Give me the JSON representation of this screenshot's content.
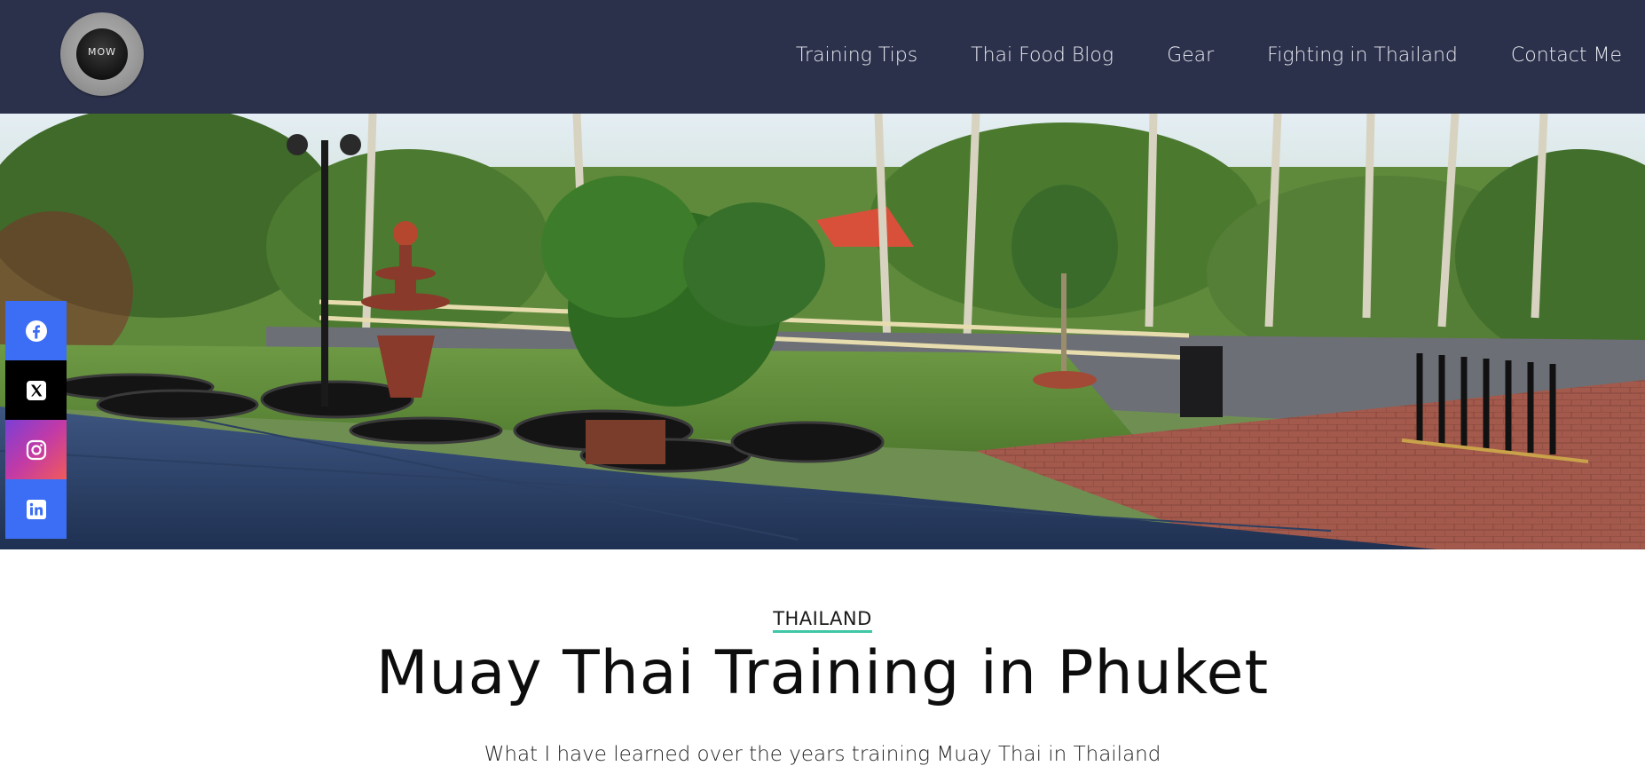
{
  "header": {
    "logo_text": "MOW",
    "nav": [
      {
        "label": "Training Tips"
      },
      {
        "label": "Thai Food Blog"
      },
      {
        "label": "Gear"
      },
      {
        "label": "Fighting in Thailand"
      },
      {
        "label": "Contact Me"
      }
    ],
    "background_color": "#2b304b"
  },
  "hero": {
    "icon": "gym-photo"
  },
  "social": [
    {
      "icon": "facebook-icon",
      "color": "#3b6ef4"
    },
    {
      "icon": "x-icon",
      "color": "#000000"
    },
    {
      "icon": "instagram-icon",
      "color": "#c23aa6"
    },
    {
      "icon": "linkedin-icon",
      "color": "#3b6ef4"
    }
  ],
  "article": {
    "category": "THAILAND",
    "title": "Muay Thai Training in Phuket",
    "subtitle": "What I have learned over the years training Muay Thai in Thailand"
  },
  "accent_color": "#3fc7a8"
}
